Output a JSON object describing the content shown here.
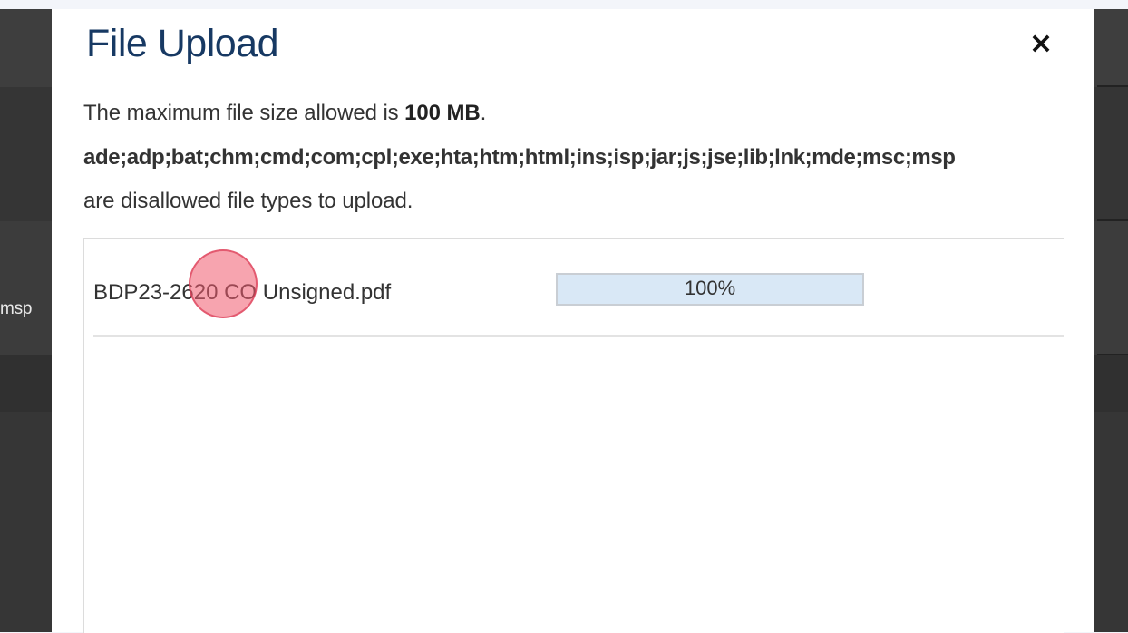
{
  "background": {
    "partial_text": "msp"
  },
  "dialog": {
    "title": "File Upload",
    "close_label": "×",
    "info": {
      "size_prefix": "The maximum file size allowed is ",
      "size_value": "100 MB",
      "size_suffix": ".",
      "disallowed_types": "ade;adp;bat;chm;cmd;com;cpl;exe;hta;htm;html;ins;isp;jar;js;jse;lib;lnk;mde;msc;msp",
      "disallowed_suffix": "are disallowed file types to upload."
    },
    "files": [
      {
        "name": "BDP23-2620 CO Unsigned.pdf",
        "progress_percent": 100,
        "progress_label": "100%"
      }
    ]
  },
  "colors": {
    "title": "#173963",
    "progress_fill": "#d9e8f6",
    "click_marker": "#f05a6e"
  }
}
